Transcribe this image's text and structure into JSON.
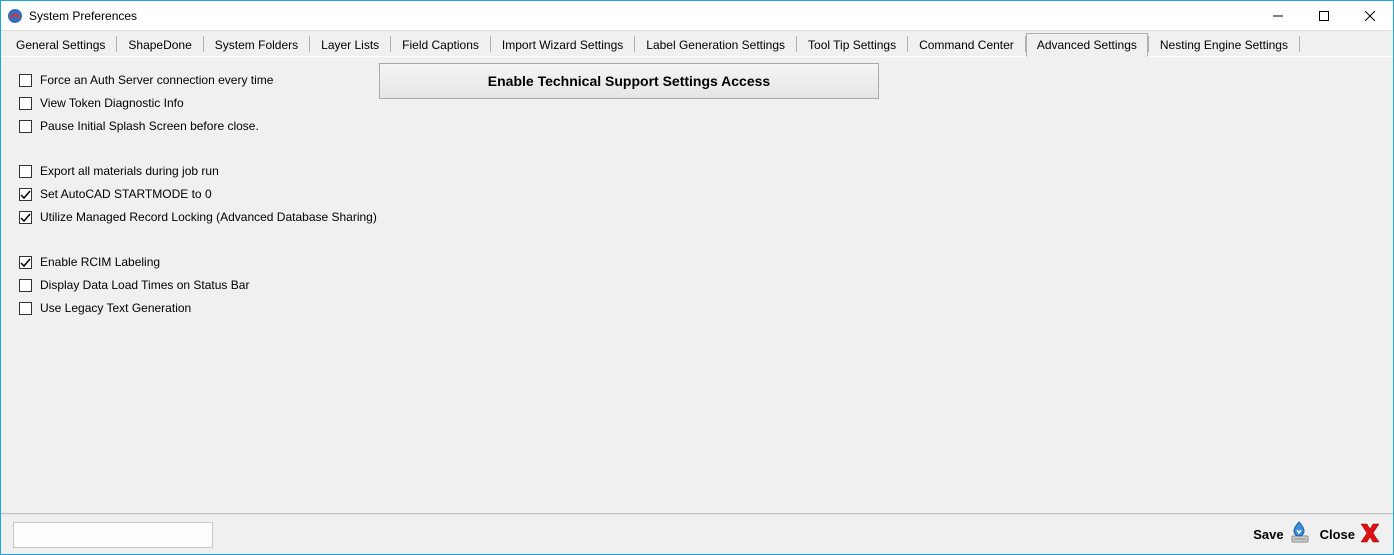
{
  "window": {
    "title": "System Preferences"
  },
  "tabs": [
    {
      "label": "General Settings"
    },
    {
      "label": "ShapeDone"
    },
    {
      "label": "System Folders"
    },
    {
      "label": "Layer Lists"
    },
    {
      "label": "Field Captions"
    },
    {
      "label": "Import Wizard Settings"
    },
    {
      "label": "Label Generation Settings"
    },
    {
      "label": "Tool Tip Settings"
    },
    {
      "label": "Command Center"
    },
    {
      "label": "Advanced Settings",
      "active": true
    },
    {
      "label": "Nesting Engine Settings"
    }
  ],
  "advanced": {
    "support_button": "Enable Technical Support Settings Access",
    "group1": [
      {
        "label": "Force an Auth Server connection every time",
        "checked": false
      },
      {
        "label": "View Token Diagnostic Info",
        "checked": false
      },
      {
        "label": "Pause Initial Splash Screen before close.",
        "checked": false
      }
    ],
    "group2": [
      {
        "label": "Export all materials during job run",
        "checked": false
      },
      {
        "label": "Set AutoCAD STARTMODE to 0",
        "checked": true
      },
      {
        "label": "Utilize Managed Record Locking (Advanced Database Sharing)",
        "checked": true
      }
    ],
    "group3": [
      {
        "label": "Enable RCIM Labeling",
        "checked": true
      },
      {
        "label": "Display Data Load Times on Status Bar",
        "checked": false
      },
      {
        "label": "Use Legacy Text Generation",
        "checked": false
      }
    ]
  },
  "footer": {
    "save": "Save",
    "close": "Close"
  }
}
